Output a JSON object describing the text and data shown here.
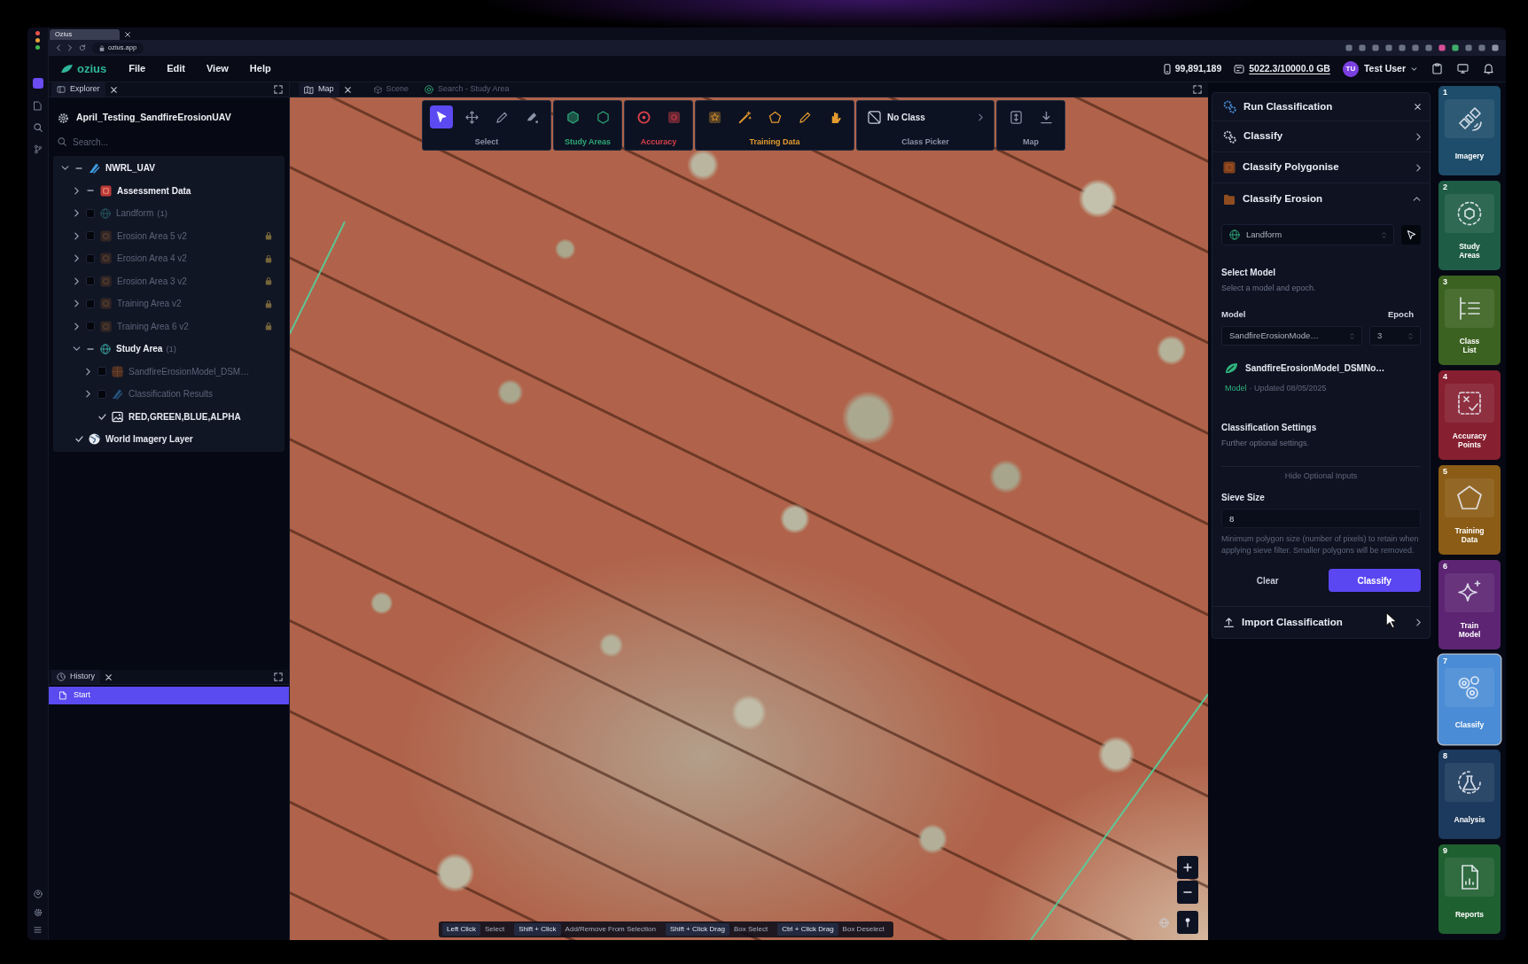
{
  "browser": {
    "tab_title": "Ozius",
    "url": "ozius.app"
  },
  "menu_bar": {
    "logo": "ozius",
    "menus": [
      "File",
      "Edit",
      "View",
      "Help"
    ],
    "credits": "99,891,189",
    "storage": "5022.3/10000.0 GB",
    "user": {
      "initials": "TU",
      "name": "Test User"
    }
  },
  "explorer": {
    "tab": "Explorer",
    "project": "April_Testing_SandfireErosionUAV",
    "search": {
      "placeholder": "Search..."
    },
    "tree": [
      {
        "label": "NWRL_UAV",
        "kind": "drone",
        "checked": false,
        "indeterminate": true,
        "expandable": true,
        "expanded": true,
        "locked": false,
        "children": [
          {
            "label": "Assessment Data",
            "kind": "folder",
            "checked": false,
            "indeterminate": true,
            "expandable": true,
            "expanded": false,
            "locked": false
          },
          {
            "label": "Landform",
            "count": "(1)",
            "kind": "globe",
            "checked": false,
            "indeterminate": false,
            "expandable": true,
            "expanded": false,
            "locked": false
          },
          {
            "label": "Erosion Area 5 v2",
            "kind": "polygons",
            "checked": false,
            "indeterminate": false,
            "expandable": true,
            "expanded": false,
            "locked": true
          },
          {
            "label": "Erosion Area 4 v2",
            "kind": "polygons",
            "checked": false,
            "indeterminate": false,
            "expandable": true,
            "expanded": false,
            "locked": true
          },
          {
            "label": "Erosion Area 3 v2",
            "kind": "polygons",
            "checked": false,
            "indeterminate": false,
            "expandable": true,
            "expanded": false,
            "locked": true
          },
          {
            "label": "Training Area v2",
            "kind": "polygons",
            "checked": false,
            "indeterminate": false,
            "expandable": true,
            "expanded": false,
            "locked": true
          },
          {
            "label": "Training Area 6 v2",
            "kind": "polygons",
            "checked": false,
            "indeterminate": false,
            "expandable": true,
            "expanded": false,
            "locked": true
          },
          {
            "label": "Study Area",
            "count": "(1)",
            "kind": "globe",
            "checked": false,
            "indeterminate": true,
            "expandable": true,
            "expanded": true,
            "locked": false,
            "children": [
              {
                "label": "SandfireErosionModel_DSM…",
                "kind": "raster",
                "checked": false,
                "indeterminate": false,
                "expandable": true,
                "expanded": false,
                "locked": false
              },
              {
                "label": "Classification Results",
                "kind": "drone",
                "checked": false,
                "indeterminate": false,
                "expandable": true,
                "expanded": false,
                "locked": false
              },
              {
                "label": "RED,GREEN,BLUE,ALPHA",
                "kind": "image",
                "checked": true,
                "indeterminate": false,
                "expandable": false,
                "expanded": false,
                "locked": false
              }
            ]
          }
        ]
      },
      {
        "label": "World Imagery Layer",
        "kind": "world",
        "checked": true,
        "indeterminate": false,
        "expandable": false,
        "expanded": false,
        "locked": false
      }
    ]
  },
  "history": {
    "tab": "History",
    "items": [
      {
        "label": "Start",
        "selected": true
      }
    ]
  },
  "map": {
    "tabs": [
      {
        "label": "Map",
        "kind": "map",
        "selected": true
      },
      {
        "label": "Scene",
        "kind": "cube",
        "selected": false
      },
      {
        "label": "Search - Study Area",
        "kind": "search-globe",
        "selected": false
      }
    ],
    "toolbar": [
      {
        "label": "Select",
        "color": "#8b93a7",
        "kind": "tools",
        "tools": [
          {
            "kind": "pointer",
            "selected": true
          },
          {
            "kind": "move",
            "selected": false
          },
          {
            "kind": "pencil",
            "selected": false
          },
          {
            "kind": "eraser",
            "selected": false
          }
        ]
      },
      {
        "label": "Study Areas",
        "color": "#2fa776",
        "kind": "tools",
        "tools": [
          {
            "kind": "hexagon-fill",
            "selected": false
          },
          {
            "kind": "hexagon",
            "selected": false
          }
        ]
      },
      {
        "label": "Accuracy",
        "color": "#d7404a",
        "kind": "tools",
        "tools": [
          {
            "kind": "target",
            "selected": false
          },
          {
            "kind": "square-fill",
            "selected": false
          }
        ]
      },
      {
        "label": "Training Data",
        "color": "#e39a2f",
        "kind": "tools",
        "tools": [
          {
            "kind": "badge",
            "selected": false
          },
          {
            "kind": "wand",
            "selected": false
          },
          {
            "kind": "pentagon",
            "selected": false
          },
          {
            "kind": "pencil",
            "selected": false
          },
          {
            "kind": "hand",
            "selected": false
          }
        ]
      },
      {
        "label": "Class Picker",
        "color": "#8b93a7",
        "kind": "picker",
        "picker": {
          "value": "No Class"
        }
      },
      {
        "label": "Map",
        "color": "#8b93a7",
        "kind": "tools",
        "tools": [
          {
            "kind": "layers",
            "selected": false
          },
          {
            "kind": "download",
            "selected": false
          }
        ]
      }
    ],
    "hints": [
      {
        "keys": "Left Click",
        "action": "Select"
      },
      {
        "keys": "Shift + Click",
        "action": "Add/Remove From Selection"
      },
      {
        "keys": "Shift + Click Drag",
        "action": "Box Select"
      },
      {
        "keys": "Ctrl + Click Drag",
        "action": "Box Deselect"
      }
    ]
  },
  "classification_panel": {
    "title": "Run Classification",
    "sections": [
      {
        "title": "Classify",
        "kind": "cogs",
        "expanded": false
      },
      {
        "title": "Classify Polygonise",
        "kind": "tile",
        "expanded": false
      },
      {
        "title": "Classify Erosion",
        "kind": "folder",
        "expanded": true,
        "form": {
          "layer": {
            "value": "Landform"
          },
          "select_model": {
            "title": "Select Model",
            "subtitle": "Select a model and epoch."
          },
          "model_label": "Model",
          "epoch_label": "Epoch",
          "model": {
            "value": "SandfireErosionMode…"
          },
          "epoch": {
            "value": "3"
          },
          "model_card": {
            "name": "SandfireErosionModel_DSMNo…",
            "tag": "Model",
            "updated": "· Updated 08/05/2025"
          },
          "settings": {
            "title": "Classification Settings",
            "subtitle": "Further optional settings."
          },
          "optional_toggle": "Hide Optional Inputs",
          "sieve": {
            "label": "Sieve Size",
            "value": "8",
            "help": "Minimum polygon size (number of pixels) to retain when applying sieve filter. Smaller polygons will be removed."
          },
          "buttons": [
            {
              "label": "Clear",
              "kind": "secondary"
            },
            {
              "label": "Classify",
              "kind": "primary"
            }
          ]
        }
      },
      {
        "title": "Import Classification",
        "kind": "upload",
        "expanded": false
      }
    ]
  },
  "workflow": [
    {
      "number": "1",
      "label": "Imagery",
      "kind": "satellite",
      "color": "#1d4d6a",
      "selected": false
    },
    {
      "number": "2",
      "label": "Study Areas",
      "kind": "hexagon-dashed",
      "color": "#1e5c45",
      "selected": false
    },
    {
      "number": "3",
      "label": "Class List",
      "kind": "list",
      "color": "#3c6221",
      "selected": false
    },
    {
      "number": "4",
      "label": "Accuracy Points",
      "kind": "check-square",
      "color": "#861f30",
      "selected": false
    },
    {
      "number": "5",
      "label": "Training Data",
      "kind": "pentagon",
      "color": "#8a5c15",
      "selected": false
    },
    {
      "number": "6",
      "label": "Train Model",
      "kind": "sparkle",
      "color": "#5c2472",
      "selected": false
    },
    {
      "number": "7",
      "label": "Classify",
      "kind": "cogs",
      "color": "#4a8cd5",
      "selected": true
    },
    {
      "number": "8",
      "label": "Analysis",
      "kind": "flask",
      "color": "#1c3a5d",
      "selected": false
    },
    {
      "number": "9",
      "label": "Reports",
      "kind": "report",
      "color": "#1f6030",
      "selected": false
    }
  ]
}
